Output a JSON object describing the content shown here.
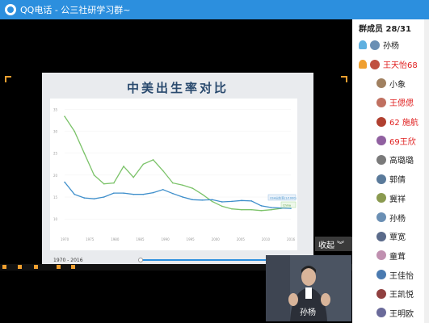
{
  "window": {
    "app": "QQ电话",
    "separator": " - ",
    "group": "公三社研学习群~"
  },
  "slide": {
    "title": "中美出生率对比",
    "legend_usa": "USA出生率(1/1000)",
    "legend_china": "China",
    "x_ticks": [
      "1970",
      "1975",
      "1980",
      "1985",
      "1990",
      "1995",
      "2000",
      "2005",
      "2010",
      "2016"
    ],
    "y_ticks": [
      "35",
      "30",
      "25",
      "20",
      "15",
      "10"
    ]
  },
  "chart_data": {
    "type": "line",
    "title": "中美出生率对比",
    "x": [
      1970,
      1972,
      1974,
      1976,
      1978,
      1980,
      1982,
      1984,
      1986,
      1988,
      1990,
      1992,
      1994,
      1996,
      1998,
      2000,
      2002,
      2004,
      2006,
      2008,
      2010,
      2012,
      2014,
      2016
    ],
    "series": [
      {
        "name": "China",
        "color": "#7cc36a",
        "values": [
          33.4,
          30,
          25,
          20,
          18,
          18.2,
          22,
          19.5,
          22.5,
          23.5,
          21,
          18.2,
          17.7,
          17,
          15.6,
          14,
          12.9,
          12.3,
          12.1,
          12.1,
          11.9,
          12.1,
          12.4,
          12.9
        ]
      },
      {
        "name": "USA",
        "color": "#3f8fcb",
        "values": [
          18.4,
          15.6,
          14.8,
          14.6,
          15,
          15.9,
          15.9,
          15.6,
          15.6,
          16,
          16.7,
          15.8,
          15,
          14.4,
          14.3,
          14.4,
          13.9,
          14,
          14.2,
          14.1,
          13,
          12.6,
          12.5,
          12.4
        ]
      }
    ],
    "xlim": [
      1970,
      2016
    ],
    "ylim": [
      8,
      36
    ]
  },
  "player": {
    "range": "1970 - 2016",
    "progress": 0.33
  },
  "collapse_label": "收起",
  "video": {
    "caption": "孙杨"
  },
  "sidebar": {
    "header": "群成员 28/31",
    "members": [
      {
        "name": "孙杨",
        "role": "owner",
        "highlight": false,
        "avatar": "#6a8fb4"
      },
      {
        "name": "王天怡68",
        "role": "admin",
        "highlight": true,
        "avatar": "#c05040"
      },
      {
        "name": "小象",
        "role": "",
        "highlight": false,
        "avatar": "#a08060"
      },
      {
        "name": "王偲偲",
        "role": "",
        "highlight": true,
        "avatar": "#c07060"
      },
      {
        "name": "62 施航",
        "role": "",
        "highlight": true,
        "avatar": "#b04030"
      },
      {
        "name": "69王欣",
        "role": "",
        "highlight": true,
        "avatar": "#9060a0"
      },
      {
        "name": "高璐璐",
        "role": "",
        "highlight": false,
        "avatar": "#7a7a7a"
      },
      {
        "name": "郭倩",
        "role": "",
        "highlight": false,
        "avatar": "#5a7a9a"
      },
      {
        "name": "冀祥",
        "role": "",
        "highlight": false,
        "avatar": "#8a9a50"
      },
      {
        "name": "孙杨",
        "role": "",
        "highlight": false,
        "avatar": "#6a8fb4"
      },
      {
        "name": "覃宽",
        "role": "",
        "highlight": false,
        "avatar": "#5a6a8a"
      },
      {
        "name": "童茸",
        "role": "",
        "highlight": false,
        "avatar": "#c090b0"
      },
      {
        "name": "王佳怡",
        "role": "",
        "highlight": false,
        "avatar": "#4a7ab0"
      },
      {
        "name": "王凯悦",
        "role": "",
        "highlight": false,
        "avatar": "#904040"
      },
      {
        "name": "王明欧",
        "role": "",
        "highlight": false,
        "avatar": "#6a6a9a"
      }
    ]
  }
}
